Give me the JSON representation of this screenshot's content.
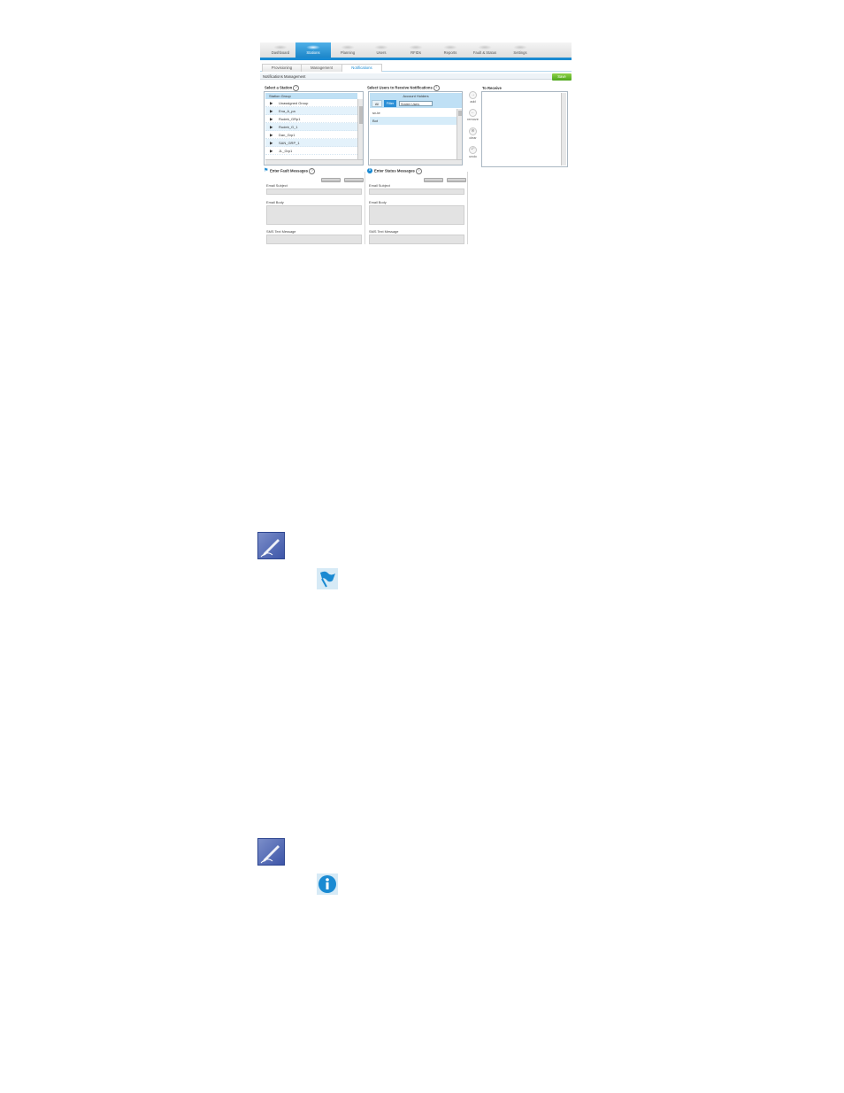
{
  "nav": {
    "items": [
      {
        "label": "Dashboard"
      },
      {
        "label": "Stations"
      },
      {
        "label": "Planning"
      },
      {
        "label": "Users"
      },
      {
        "label": "RFIDs"
      },
      {
        "label": "Reports"
      },
      {
        "label": "Fault & Status"
      },
      {
        "label": "Settings"
      }
    ],
    "active_index": 1
  },
  "subtabs": [
    "Provisioning",
    "Management",
    "Notifications"
  ],
  "page_title": "Notifications Management",
  "save_label": "Save",
  "station_section": {
    "label": "Select a Station",
    "header": "Station Group",
    "rows": [
      "Unassigned Group",
      "Ena_A_pa",
      "Rudeb_GRp1",
      "Rudeb_G_1",
      "Dan_Grp1",
      "SAN_GRP_1",
      "JL_Grp1"
    ]
  },
  "users_section": {
    "label": "Select Users to Receive Notifications",
    "header": "Account Holders",
    "tab_all": "All",
    "tab_filter": "Filter",
    "filter_value": "System Users",
    "rows": [
      "sv-te",
      "Bot"
    ]
  },
  "transfer": {
    "add": "add",
    "remove": "remove",
    "clear": "clear",
    "undo": "undo"
  },
  "to_receive_label": "To Receive",
  "fault": {
    "label": "Enter Fault Messages",
    "email_subject": "Email Subject",
    "email_body": "Email Body",
    "sms": "SMS Text Message"
  },
  "status": {
    "label": "Enter Status Messages",
    "email_subject": "Email Subject",
    "email_body": "Email Body",
    "sms": "SMS Text Message"
  },
  "colors": {
    "accent": "#1a8ad2",
    "save": "#5bb527",
    "note_icon": "#4c63b0"
  },
  "icons": [
    "note-pen-icon",
    "fault-flag-icon",
    "note-pen-icon",
    "info-icon"
  ]
}
